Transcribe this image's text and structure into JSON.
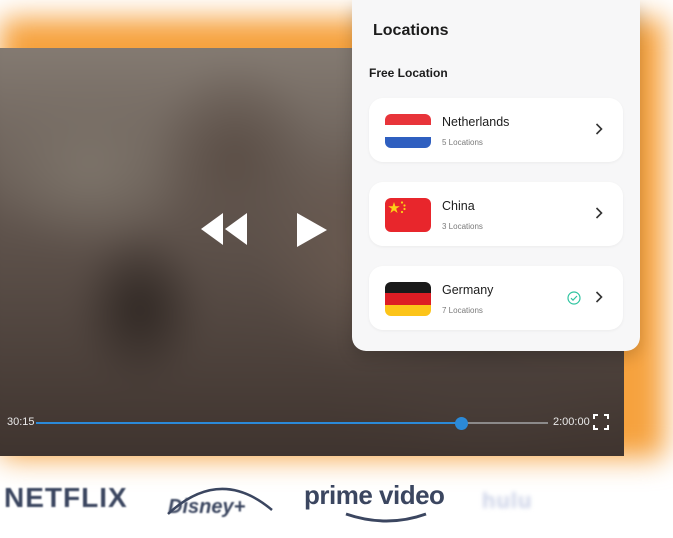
{
  "player": {
    "current_time": "30:15",
    "total_time": "2:00:00",
    "progress": 0.83,
    "icons": [
      "rewind-icon",
      "play-icon",
      "fullscreen-icon"
    ],
    "accent": "#2b8ad8"
  },
  "locations_panel": {
    "title": "Locations",
    "section_label": "Free Location",
    "items": [
      {
        "name": "Netherlands",
        "count": "5 Locations",
        "flag": [
          "#e8343a",
          "#ffffff",
          "#2f5fc0"
        ],
        "selected": false
      },
      {
        "name": "China",
        "count": "3 Locations",
        "flag": [
          "#e8262c"
        ],
        "selected": false
      },
      {
        "name": "Germany",
        "count": "7 Locations",
        "flag": [
          "#1a1a1a",
          "#dd1d24",
          "#fcc419"
        ],
        "selected": true
      }
    ],
    "check_color": "#2fc4a0"
  },
  "logos": {
    "netflix": "NETFLIX",
    "disney": "Disney+",
    "prime": "prime video",
    "hulu": "hulu"
  }
}
